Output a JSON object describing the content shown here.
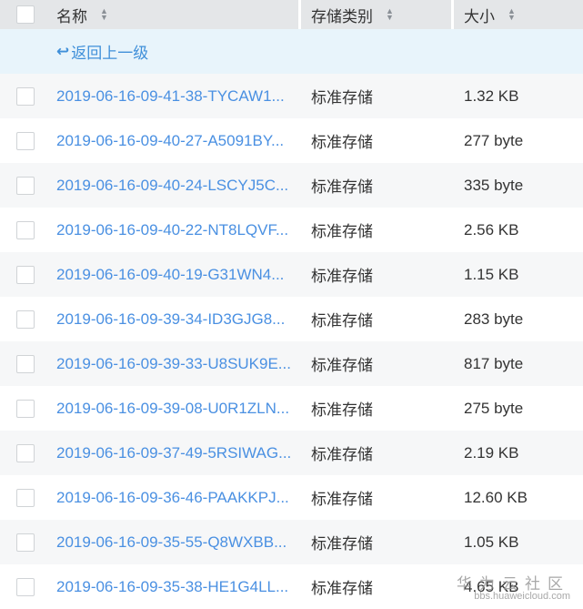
{
  "header": {
    "name": "名称",
    "type": "存储类别",
    "size": "大小"
  },
  "back_label": "返回上一级",
  "rows": [
    {
      "name": "2019-06-16-09-41-38-TYCAW1...",
      "type": "标准存储",
      "size": "1.32 KB"
    },
    {
      "name": "2019-06-16-09-40-27-A5091BY...",
      "type": "标准存储",
      "size": "277 byte"
    },
    {
      "name": "2019-06-16-09-40-24-LSCYJ5C...",
      "type": "标准存储",
      "size": "335 byte"
    },
    {
      "name": "2019-06-16-09-40-22-NT8LQVF...",
      "type": "标准存储",
      "size": "2.56 KB"
    },
    {
      "name": "2019-06-16-09-40-19-G31WN4...",
      "type": "标准存储",
      "size": "1.15 KB"
    },
    {
      "name": "2019-06-16-09-39-34-ID3GJG8...",
      "type": "标准存储",
      "size": "283 byte"
    },
    {
      "name": "2019-06-16-09-39-33-U8SUK9E...",
      "type": "标准存储",
      "size": "817 byte"
    },
    {
      "name": "2019-06-16-09-39-08-U0R1ZLN...",
      "type": "标准存储",
      "size": "275 byte"
    },
    {
      "name": "2019-06-16-09-37-49-5RSIWAG...",
      "type": "标准存储",
      "size": "2.19 KB"
    },
    {
      "name": "2019-06-16-09-36-46-PAAKKPJ...",
      "type": "标准存储",
      "size": "12.60 KB"
    },
    {
      "name": "2019-06-16-09-35-55-Q8WXBB...",
      "type": "标准存储",
      "size": "1.05 KB"
    },
    {
      "name": "2019-06-16-09-35-38-HE1G4LL...",
      "type": "标准存储",
      "size": "4.65 KB"
    }
  ],
  "watermark": {
    "title": "华为云社区",
    "url": "bbs.huaweicloud.com"
  }
}
